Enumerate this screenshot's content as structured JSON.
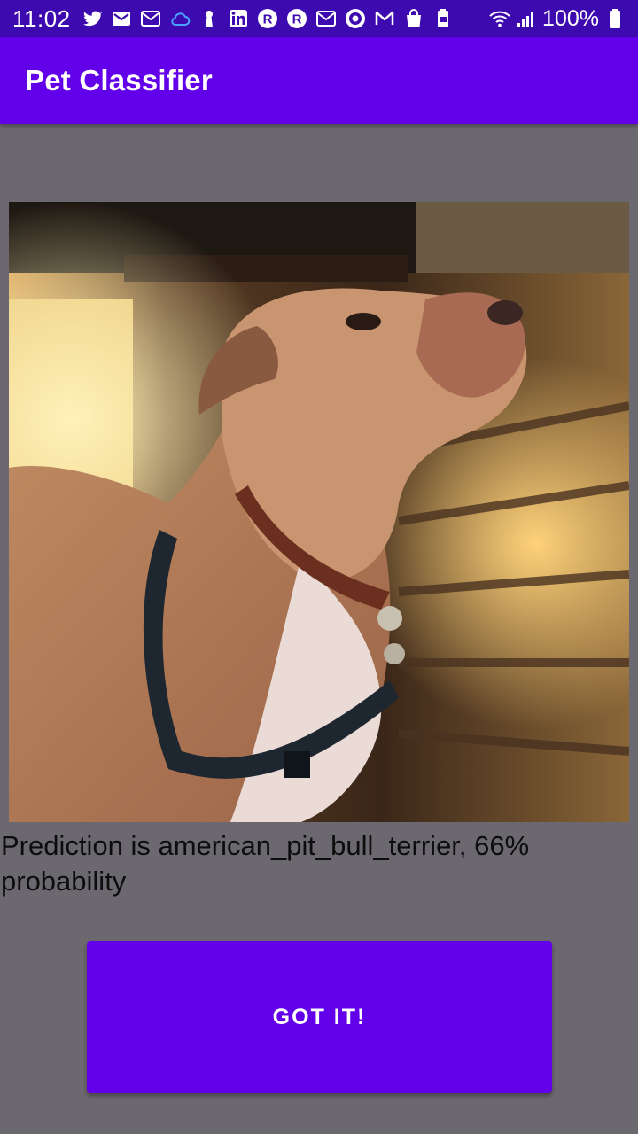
{
  "status_bar": {
    "time": "11:02",
    "battery_percent": "100%",
    "notification_icons": [
      "twitter-icon",
      "gmail-icon",
      "gmail-icon",
      "cloud-icon",
      "keyhole-icon",
      "linkedin-icon",
      "r-icon",
      "r-icon",
      "mail-icon",
      "shield-icon",
      "m-icon",
      "bag-icon",
      "battery-saver-icon"
    ]
  },
  "app_bar": {
    "title": "Pet Classifier"
  },
  "photo": {
    "subject": "dog-photo"
  },
  "result": {
    "prediction_text": "Prediction is american_pit_bull_terrier, 66% probability"
  },
  "actions": {
    "got_it_label": "GOT IT!"
  },
  "colors": {
    "status_bar": "#3d0aaf",
    "app_bar": "#6200ea",
    "background": "#6c686f",
    "button": "#6200ea"
  }
}
